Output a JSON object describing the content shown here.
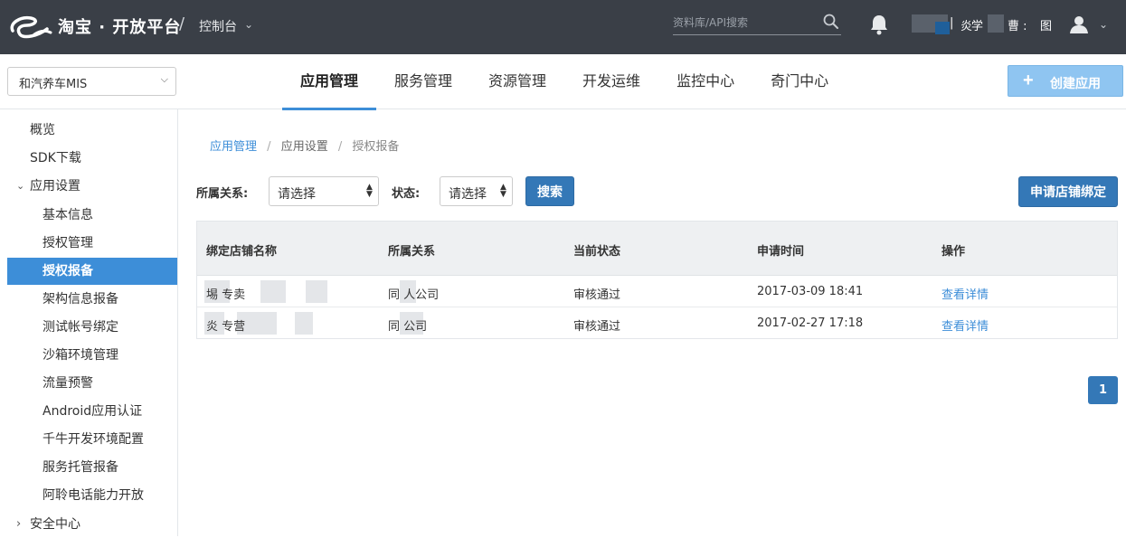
{
  "header": {
    "brand": "淘宝 · 开放平台",
    "separator": "/",
    "console_label": "控制台",
    "search_placeholder": "资料库/API搜索",
    "user_name_fragments": [
      "| ",
      "炎",
      "学",
      "曹 :",
      "图"
    ]
  },
  "app_selector": {
    "value": "和汽养车MIS"
  },
  "nav": {
    "tabs": [
      {
        "label": "应用管理",
        "active": true
      },
      {
        "label": "服务管理",
        "active": false
      },
      {
        "label": "资源管理",
        "active": false
      },
      {
        "label": "开发运维",
        "active": false
      },
      {
        "label": "监控中心",
        "active": false
      },
      {
        "label": "奇门中心",
        "active": false
      }
    ],
    "create_button": "创建应用"
  },
  "sidebar": {
    "items": [
      {
        "label": "概览",
        "level": 0
      },
      {
        "label": "SDK下载",
        "level": 0
      },
      {
        "label": "应用设置",
        "level": 0,
        "expanded": true
      },
      {
        "label": "基本信息",
        "level": 1
      },
      {
        "label": "授权管理",
        "level": 1
      },
      {
        "label": "授权报备",
        "level": 1,
        "active": true
      },
      {
        "label": "架构信息报备",
        "level": 1
      },
      {
        "label": "测试帐号绑定",
        "level": 1
      },
      {
        "label": "沙箱环境管理",
        "level": 1
      },
      {
        "label": "流量预警",
        "level": 1
      },
      {
        "label": "Android应用认证",
        "level": 1
      },
      {
        "label": "千牛开发环境配置",
        "level": 1
      },
      {
        "label": "服务托管报备",
        "level": 1
      },
      {
        "label": "阿聆电话能力开放",
        "level": 1
      },
      {
        "label": "安全中心",
        "level": 0,
        "expanded": false
      }
    ]
  },
  "breadcrumb": {
    "items": [
      "应用管理",
      "应用设置",
      "授权报备"
    ],
    "separator": "/"
  },
  "filters": {
    "relation_label": "所属关系:",
    "relation_value": "请选择",
    "status_label": "状态:",
    "status_value": "请选择",
    "search_button": "搜索",
    "bind_button": "申请店铺绑定"
  },
  "table": {
    "columns": [
      "绑定店铺名称",
      "所属关系",
      "当前状态",
      "申请时间",
      "操作"
    ],
    "rows": [
      {
        "shop": "  埸    专卖",
        "relation": "同   人公司",
        "status": "审核通过",
        "time": "2017-03-09 18:41",
        "action": "查看详情"
      },
      {
        "shop": "  炎     专营",
        "relation": "同   公司",
        "status": "审核通过",
        "time": "2017-02-27 17:18",
        "action": "查看详情"
      }
    ]
  },
  "pagination": {
    "current": "1"
  },
  "colors": {
    "topbar": "#3a3f47",
    "accent": "#3d8ed8",
    "primary_button": "#3478b7",
    "disabled_button": "#8fc5f1"
  }
}
